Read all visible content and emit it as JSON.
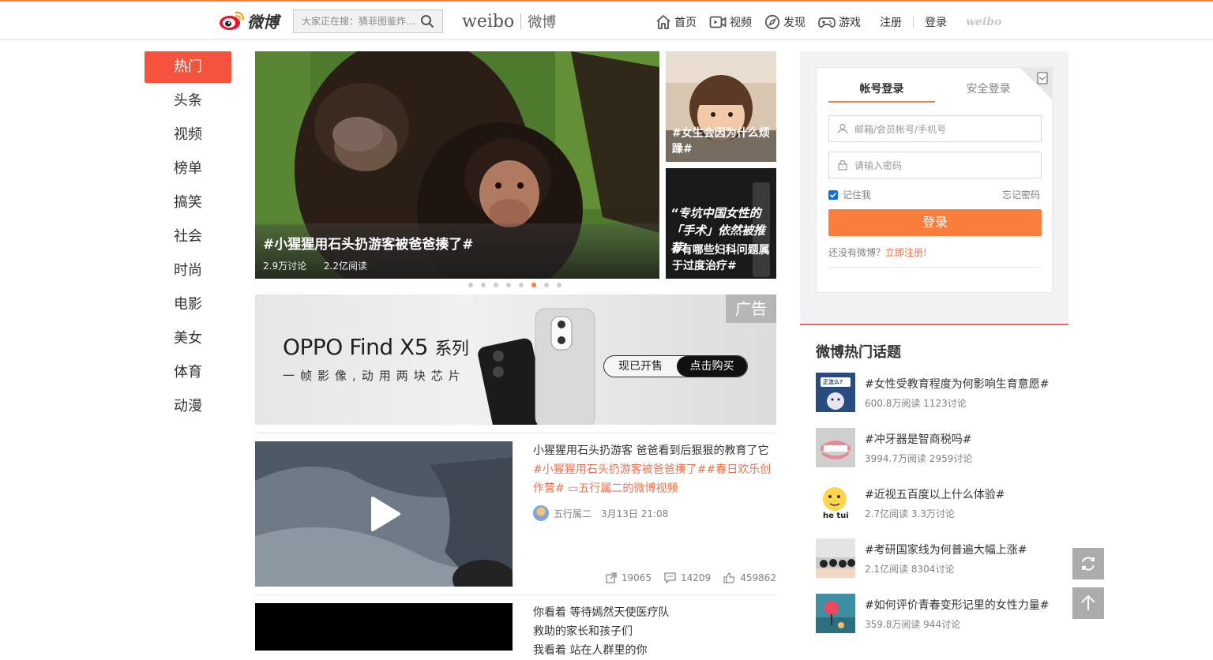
{
  "header": {
    "logo_text": "微博",
    "search_placeholder": "大家正在搜：猜菲图鉴炸…",
    "brand_en": "weibo",
    "brand_cn": "微博",
    "nav": [
      {
        "label": "首页",
        "icon": "home-icon"
      },
      {
        "label": "视频",
        "icon": "video-icon"
      },
      {
        "label": "发现",
        "icon": "discover-icon"
      },
      {
        "label": "游戏",
        "icon": "game-icon"
      }
    ],
    "register_label": "注册",
    "login_label": "登录",
    "weibo_mini": "weibo"
  },
  "sidebar": {
    "items": [
      {
        "label": "热门",
        "active": true
      },
      {
        "label": "头条"
      },
      {
        "label": "视频"
      },
      {
        "label": "榜单"
      },
      {
        "label": "搞笑"
      },
      {
        "label": "社会"
      },
      {
        "label": "时尚"
      },
      {
        "label": "电影"
      },
      {
        "label": "美女"
      },
      {
        "label": "体育"
      },
      {
        "label": "动漫"
      }
    ]
  },
  "hero": {
    "title": "#小猩猩用石头扔游客被爸爸揍了#",
    "discussions": "2.9万讨论",
    "reads": "2.2亿阅读",
    "side": [
      {
        "caption": "#女生会因为什么烦躁#"
      },
      {
        "quote": "“专坑中国女性的「手术」依然被推荐!",
        "caption": "#有哪些妇科问题属于过度治疗#"
      }
    ],
    "dots_active_index": 5,
    "dots_count": 8
  },
  "ad": {
    "brand": "OPPO Find X5",
    "series": "系列",
    "subtitle": "一帧影像,动用两块芯片",
    "tag": "广告",
    "btn_on_sale": "现已开售",
    "btn_buy": "点击购买"
  },
  "feed": [
    {
      "text": "小猩猩用石头扔游客 爸爸看到后狠狠的教育了它",
      "tags": "#小猩猩用石头扔游客被爸爸揍了##春日欢乐创作营# ",
      "video_link": "五行属二的微博视频",
      "author": "五行属二",
      "time": "3月13日 21:08",
      "reposts": "19065",
      "comments": "14209",
      "likes": "459862"
    },
    {
      "lines": [
        "你看着 等待嫣然天使医疗队",
        "救助的家长和孩子们",
        "我看着 站在人群里的你"
      ]
    }
  ],
  "login": {
    "tab_account": "帐号登录",
    "tab_secure": "安全登录",
    "username_placeholder": "邮箱/会员帐号/手机号",
    "password_placeholder": "请输入密码",
    "remember": "记住我",
    "forgot": "忘记密码",
    "submit": "登录",
    "no_account": "还没有微博？",
    "register_now": "立即注册!"
  },
  "hot_topics": {
    "title": "微博热门话题",
    "items": [
      {
        "name": "#女性受教育程度为何影响生育意愿#",
        "meta": "600.8万阅读 1123讨论"
      },
      {
        "name": "#冲牙器是智商税吗#",
        "meta": "3994.7万阅读 2959讨论"
      },
      {
        "name": "#近视五百度以上什么体验#",
        "meta": "2.7亿阅读 3.3万讨论"
      },
      {
        "name": "#考研国家线为何普遍大幅上涨#",
        "meta": "2.1亿阅读 8304讨论"
      },
      {
        "name": "#如何评价青春变形记里的女性力量#",
        "meta": "359.8万阅读 944讨论"
      }
    ],
    "thumb_text": [
      "正怎么?",
      "he tui"
    ]
  },
  "colors": {
    "accent": "#fa7d3c",
    "active_menu": "#f5533d",
    "tag_orange": "#eb7350"
  }
}
